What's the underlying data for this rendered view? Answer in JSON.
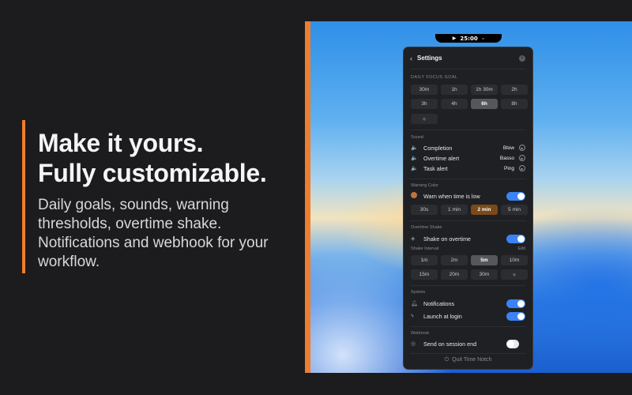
{
  "marketing": {
    "headline_line1": "Make it yours.",
    "headline_line2": "Fully customizable.",
    "subcopy": "Daily goals, sounds, warning thresholds, overtime shake. Notifications and webhook for your workflow."
  },
  "notch": {
    "play_icon": "▶",
    "time": "25:00",
    "dash": "–"
  },
  "settings": {
    "back_icon": "‹",
    "title": "Settings",
    "close_icon": "×",
    "daily_goal": {
      "label": "DAILY FOCUS GOAL",
      "options": [
        "30m",
        "1h",
        "1h 30m",
        "2h",
        "3h",
        "4h",
        "6h",
        "8h"
      ],
      "selected": "6h",
      "add_label": "+"
    },
    "sound": {
      "label": "Sound",
      "items": [
        {
          "label": "Completion",
          "value": "Blow"
        },
        {
          "label": "Overtime alert",
          "value": "Basso"
        },
        {
          "label": "Task alert",
          "value": "Ping"
        }
      ],
      "speaker_icon": "🔈",
      "play_icon": "▶"
    },
    "warning": {
      "label": "Warning Color",
      "toggle_label": "Warn when time is low",
      "enabled": true,
      "options": [
        "30s",
        "1 min",
        "2 min",
        "5 min"
      ],
      "selected": "2 min"
    },
    "overtime": {
      "label": "Overtime Shake",
      "toggle_label": "Shake on overtime",
      "enabled": true,
      "interval_label": "Shake Interval",
      "edit_label": "Edit",
      "options": [
        "1m",
        "2m",
        "5m",
        "10m",
        "15m",
        "20m",
        "30m"
      ],
      "selected": "5m",
      "add_label": "+"
    },
    "system": {
      "label": "System",
      "notifications_label": "Notifications",
      "notifications_enabled": true,
      "login_label": "Launch at login",
      "login_enabled": true
    },
    "webhook": {
      "label": "Webhook",
      "toggle_label": "Send on session end",
      "enabled": false
    },
    "quit_label": "Quit Time Notch",
    "quit_icon": "⏻"
  },
  "colors": {
    "accent_orange": "#ef7d2e",
    "toggle_blue": "#3b82f6",
    "warn_chip": "#7a4a1a",
    "panel_bg": "#1f2023"
  }
}
